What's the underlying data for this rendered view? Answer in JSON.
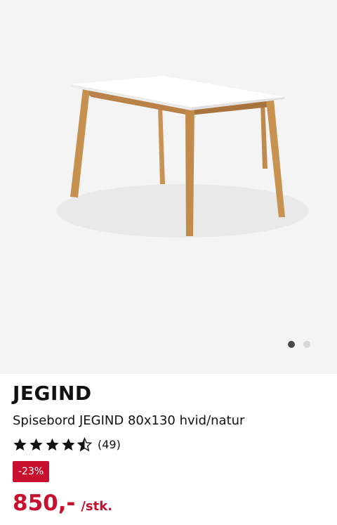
{
  "product": {
    "brand": "JEGIND",
    "title": "Spisebord JEGIND 80x130 hvid/natur",
    "rating_value": 4.5,
    "rating_count": "(49)",
    "discount_badge": "-23%",
    "price": "850,-",
    "unit": "/stk."
  },
  "gallery": {
    "image_count": 2,
    "active_index": 0,
    "image": "table-photo"
  },
  "colors": {
    "accent": "#c8102e",
    "dot_active": "#4a4a4a",
    "dot_inactive": "#d6d6d6",
    "gallery_bg": "#f4f4f4"
  }
}
